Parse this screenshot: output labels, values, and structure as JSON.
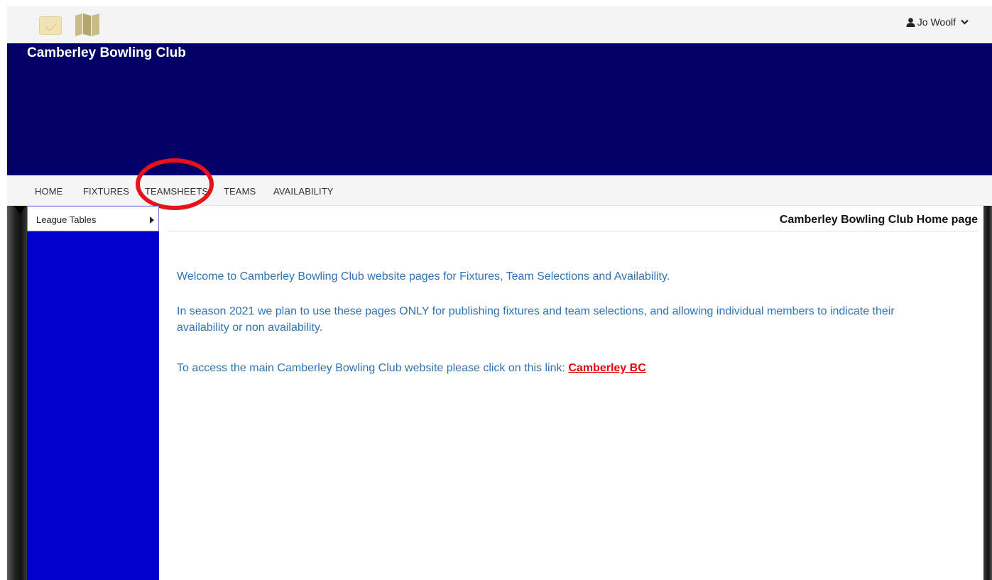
{
  "header": {
    "user_name": "Jo Woolf",
    "club_name": "Camberley Bowling Club"
  },
  "nav": {
    "items": [
      {
        "label": "HOME"
      },
      {
        "label": "FIXTURES"
      },
      {
        "label": "TEAMSHEETS"
      },
      {
        "label": "TEAMS"
      },
      {
        "label": "AVAILABILITY"
      }
    ],
    "highlighted": "TEAMSHEETS"
  },
  "sidebar": {
    "items": [
      {
        "label": "League Tables"
      }
    ]
  },
  "main": {
    "page_title": "Camberley Bowling Club Home page",
    "paragraph1": "Welcome to Camberley Bowling Club website pages for Fixtures, Team Selections and Availability.",
    "paragraph2": "In season 2021 we plan to use these pages ONLY for publishing fixtures and team selections, and allowing individual members to indicate their availability or non availability.",
    "paragraph3_prefix": "To access the main Camberley Bowling Club website please click on this link:",
    "link_label": "Camberley BC"
  },
  "colors": {
    "banner": "#000066",
    "sidebar": "#0000cc",
    "body_text": "#2f73b2",
    "link": "#e30613",
    "highlight_circle": "#e8111a"
  },
  "icons": {
    "envelope": "envelope-icon",
    "map": "map-icon",
    "user": "user-icon",
    "chevron": "chevron-down-icon"
  }
}
